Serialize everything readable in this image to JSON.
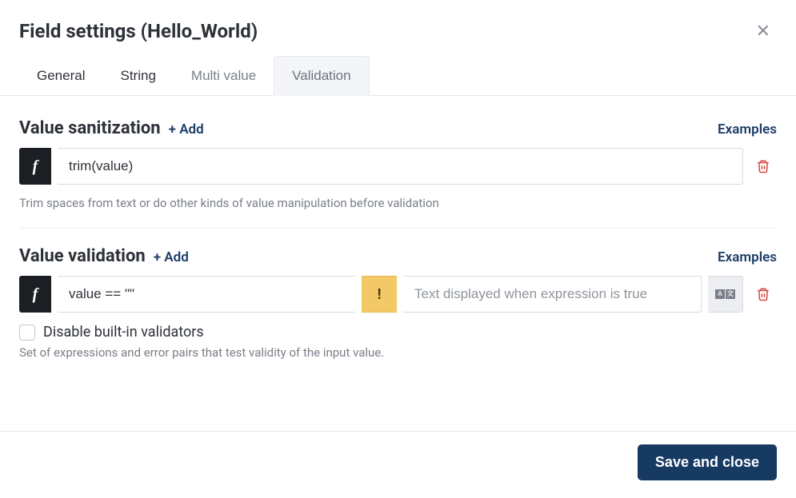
{
  "title": "Field settings (Hello_World)",
  "tabs": {
    "general": "General",
    "string": "String",
    "multi_value": "Multi value",
    "validation": "Validation"
  },
  "sanitization": {
    "heading": "Value sanitization",
    "add": "+ Add",
    "examples": "Examples",
    "expr": "trim(value)",
    "hint": "Trim spaces from text or do other kinds of value manipulation before validation"
  },
  "validation": {
    "heading": "Value validation",
    "add": "+ Add",
    "examples": "Examples",
    "expr": "value == \"\"",
    "warn_char": "!",
    "msg_placeholder": "Text displayed when expression is true",
    "disable_label": "Disable built-in validators",
    "hint": "Set of expressions and error pairs that test validity of the input value."
  },
  "footer": {
    "save": "Save and close"
  }
}
